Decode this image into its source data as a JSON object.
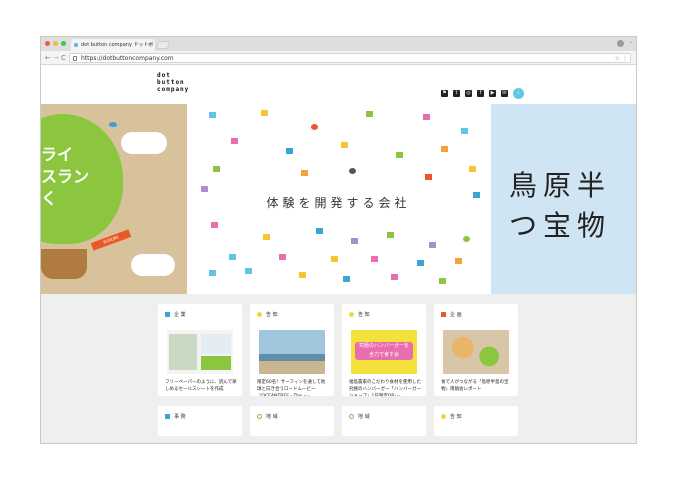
{
  "browser": {
    "tab_title": "dot button company ドットボ",
    "tab_close": "×",
    "url": "https://dotbuttoncompany.com",
    "nav_back": "←",
    "nav_forward": "→",
    "nav_reload": "C",
    "bookmark_star": "☆",
    "more_menu": "⋮",
    "minimize": "–"
  },
  "site": {
    "logo_lines": [
      "dot",
      "button",
      "company"
    ],
    "social": [
      {
        "name": "flag-icon",
        "glyph": "⚑"
      },
      {
        "name": "twitter-icon",
        "glyph": "t"
      },
      {
        "name": "instagram-icon",
        "glyph": "◎"
      },
      {
        "name": "facebook-icon",
        "glyph": "f"
      },
      {
        "name": "youtube-icon",
        "glyph": "▶"
      },
      {
        "name": "mail-icon",
        "glyph": "✉"
      }
    ],
    "menu_glyph": "⁘"
  },
  "hero": {
    "left_text": "ライ\nスラン\nく",
    "ribbon_text": "KURUMI",
    "middle_text": "体験を開発する会社",
    "right_text": "鳥原半\nつ宝物"
  },
  "cards": [
    {
      "category": "企 業",
      "color": "#3aa6d6",
      "text": "フリーペーパーのように、読んで楽しめるセールスシートを作成"
    },
    {
      "category": "告 知",
      "color": "#f2d53c",
      "text": "限定60名！サーフィンを通して地球と向き合うロードムービー『OCEANTREE - The ･･･"
    },
    {
      "category": "告 知",
      "color": "#f2d53c",
      "text": "福島農家のこだわり食材を使用した究極のハンバーガー「ハンバーガーショップ」1日限定OP･･･"
    },
    {
      "category": "企 画",
      "color": "#e8592a",
      "text": "食で人がつながる「島原半島の宝物」南鎮会レポート"
    }
  ],
  "cards_row2": [
    {
      "category": "事 務",
      "color": "#3aa6d6"
    },
    {
      "category": "地 域",
      "color": "#7ac143"
    },
    {
      "category": "地 域",
      "color": "#7ac143"
    },
    {
      "category": "告 知",
      "color": "#f2d53c"
    }
  ],
  "thumb_banner": "究極のハンバーガーを全力で食す会",
  "colors": {
    "accent": "#5fc6e6",
    "balloon": "#8cc63f",
    "kraft": "#d8c29b",
    "sky": "#cfe5f3"
  }
}
